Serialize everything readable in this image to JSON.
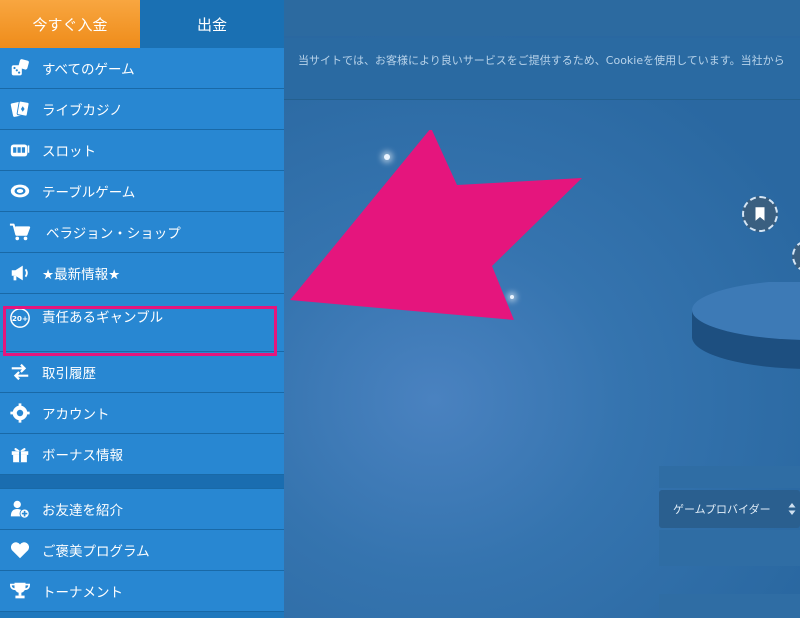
{
  "top_tabs": {
    "deposit": "今すぐ入金",
    "withdraw": "出金"
  },
  "menu": {
    "items": [
      {
        "label": "すべてのゲーム",
        "icon": "dice-icon"
      },
      {
        "label": "ライブカジノ",
        "icon": "cards-icon"
      },
      {
        "label": "スロット",
        "icon": "slot-machine-icon"
      },
      {
        "label": "テーブルゲーム",
        "icon": "chip-icon"
      },
      {
        "label": "ベラジョン・ショップ",
        "icon": "cart-icon"
      },
      {
        "label": "★最新情報★",
        "icon": "megaphone-icon"
      },
      {
        "label": "責任あるギャンブル",
        "icon": "age-20-icon"
      },
      {
        "label": "取引履歴",
        "icon": "transfer-icon"
      },
      {
        "label": "アカウント",
        "icon": "gear-icon"
      },
      {
        "label": "ボーナス情報",
        "icon": "gift-icon"
      }
    ],
    "secondary_items": [
      {
        "label": "お友達を紹介",
        "icon": "add-user-icon"
      },
      {
        "label": "ご褒美プログラム",
        "icon": "heart-icon"
      },
      {
        "label": "トーナメント",
        "icon": "trophy-icon"
      }
    ],
    "age_badge": "20+"
  },
  "cookie_notice": "当サイトでは、お客様により良いサービスをご提供するため、Cookieを使用しています。当社から",
  "provider_filter": {
    "label": "ゲームプロバイダー"
  },
  "colors": {
    "deposit_tab": "#f39a2a",
    "sidebar": "#2887d2",
    "highlight": "#e5157d",
    "arrow": "#e5157d"
  }
}
